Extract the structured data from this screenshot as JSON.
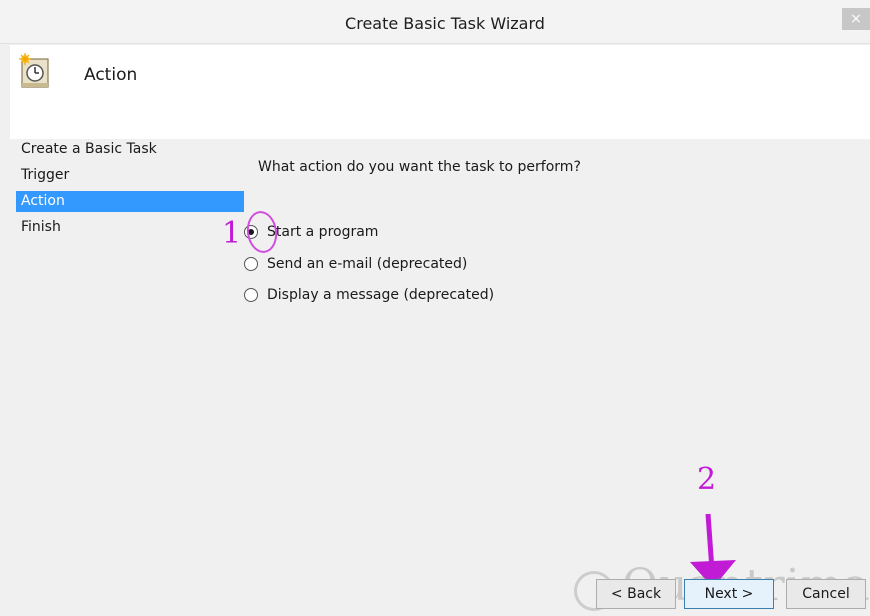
{
  "window": {
    "title": "Create Basic Task Wizard",
    "close_glyph": "×"
  },
  "header": {
    "title": "Action",
    "icon": "task-scheduler-icon"
  },
  "steps": [
    {
      "label": "Create a Basic Task"
    },
    {
      "label": "Trigger"
    },
    {
      "label": "Action"
    },
    {
      "label": "Finish"
    }
  ],
  "question": "What action do you want the task to perform?",
  "options": [
    {
      "label": "Start a program",
      "checked": true
    },
    {
      "label": "Send an e-mail (deprecated)",
      "checked": false
    },
    {
      "label": "Display a message (deprecated)",
      "checked": false
    }
  ],
  "buttons": {
    "back": "< Back",
    "next": "Next >",
    "cancel": "Cancel"
  },
  "annotations": {
    "step1": "1",
    "step2": "2",
    "color": "#c21bd6"
  },
  "watermark": "Quantrimang",
  "colors": {
    "selection": "#3399ff",
    "accent": "#c21bd6"
  }
}
